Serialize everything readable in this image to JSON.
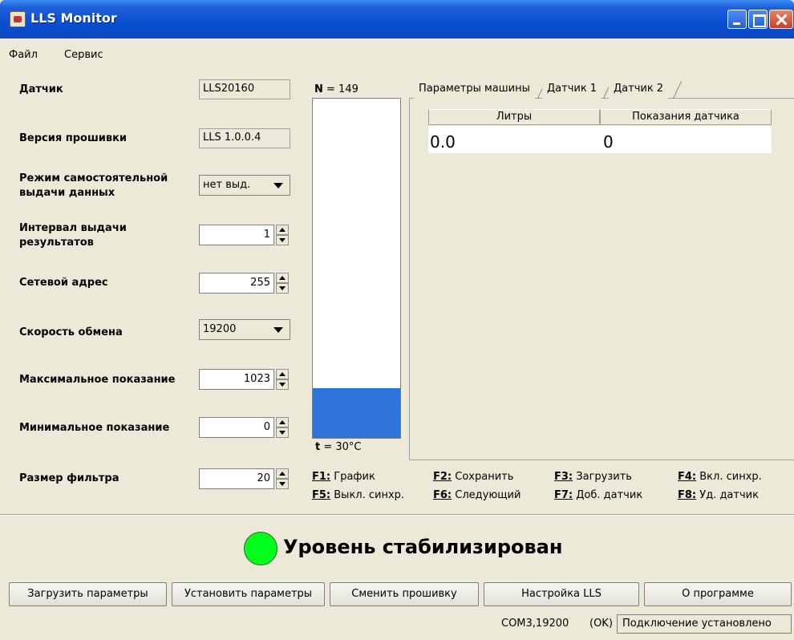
{
  "window": {
    "title": "LLS Monitor"
  },
  "menu": {
    "items": [
      "Файл",
      "Сервис"
    ]
  },
  "form": {
    "sensor": {
      "label": "Датчик",
      "value": "LLS20160"
    },
    "firmware": {
      "label": "Версия прошивки",
      "value": "LLS 1.0.0.4"
    },
    "auto_mode": {
      "label_line1": "Режим самостоятельной",
      "label_line2": "выдачи данных",
      "value": "нет выд."
    },
    "interval": {
      "label_line1": "Интервал выдачи",
      "label_line2": "результатов",
      "value": "1"
    },
    "address": {
      "label": "Сетевой адрес",
      "value": "255"
    },
    "baud": {
      "label": "Скорость обмена",
      "value": "19200"
    },
    "max_reading": {
      "label": "Максимальное показание",
      "value": "1023"
    },
    "min_reading": {
      "label": "Минимальное показание",
      "value": "0"
    },
    "filter": {
      "label": "Размер фильтра",
      "value": "20"
    }
  },
  "gauge": {
    "n_symbol": "N",
    "n_value": "= 149",
    "t_symbol": "t",
    "t_value": "= 30°C",
    "level_fraction": 0.146,
    "fill_color": "#2e73d8"
  },
  "tabs": [
    {
      "label": "Параметры машины"
    },
    {
      "label": "Датчик 1"
    },
    {
      "label": "Датчик 2"
    }
  ],
  "table": {
    "headers": [
      "Литры",
      "Показания датчика"
    ],
    "rows": [
      [
        "0.0",
        "0"
      ]
    ]
  },
  "function_keys": [
    {
      "key": "F1:",
      "label": "График"
    },
    {
      "key": "F2:",
      "label": "Сохранить"
    },
    {
      "key": "F3:",
      "label": "Загрузить"
    },
    {
      "key": "F4:",
      "label": "Вкл. синхр."
    },
    {
      "key": "F5:",
      "label": "Выкл. синхр."
    },
    {
      "key": "F6:",
      "label": "Следующий"
    },
    {
      "key": "F7:",
      "label": "Доб. датчик"
    },
    {
      "key": "F8:",
      "label": "Уд. датчик"
    }
  ],
  "status": {
    "text": "Уровень стабилизирован",
    "led_color": "#00ff1a"
  },
  "buttons": [
    "Загрузить параметры",
    "Установить параметры",
    "Сменить прошивку",
    "Настройка LLS",
    "О программе"
  ],
  "statusbar": {
    "port": "COM3,19200",
    "ok": "(OK)",
    "connection": "Подключение установлено"
  }
}
